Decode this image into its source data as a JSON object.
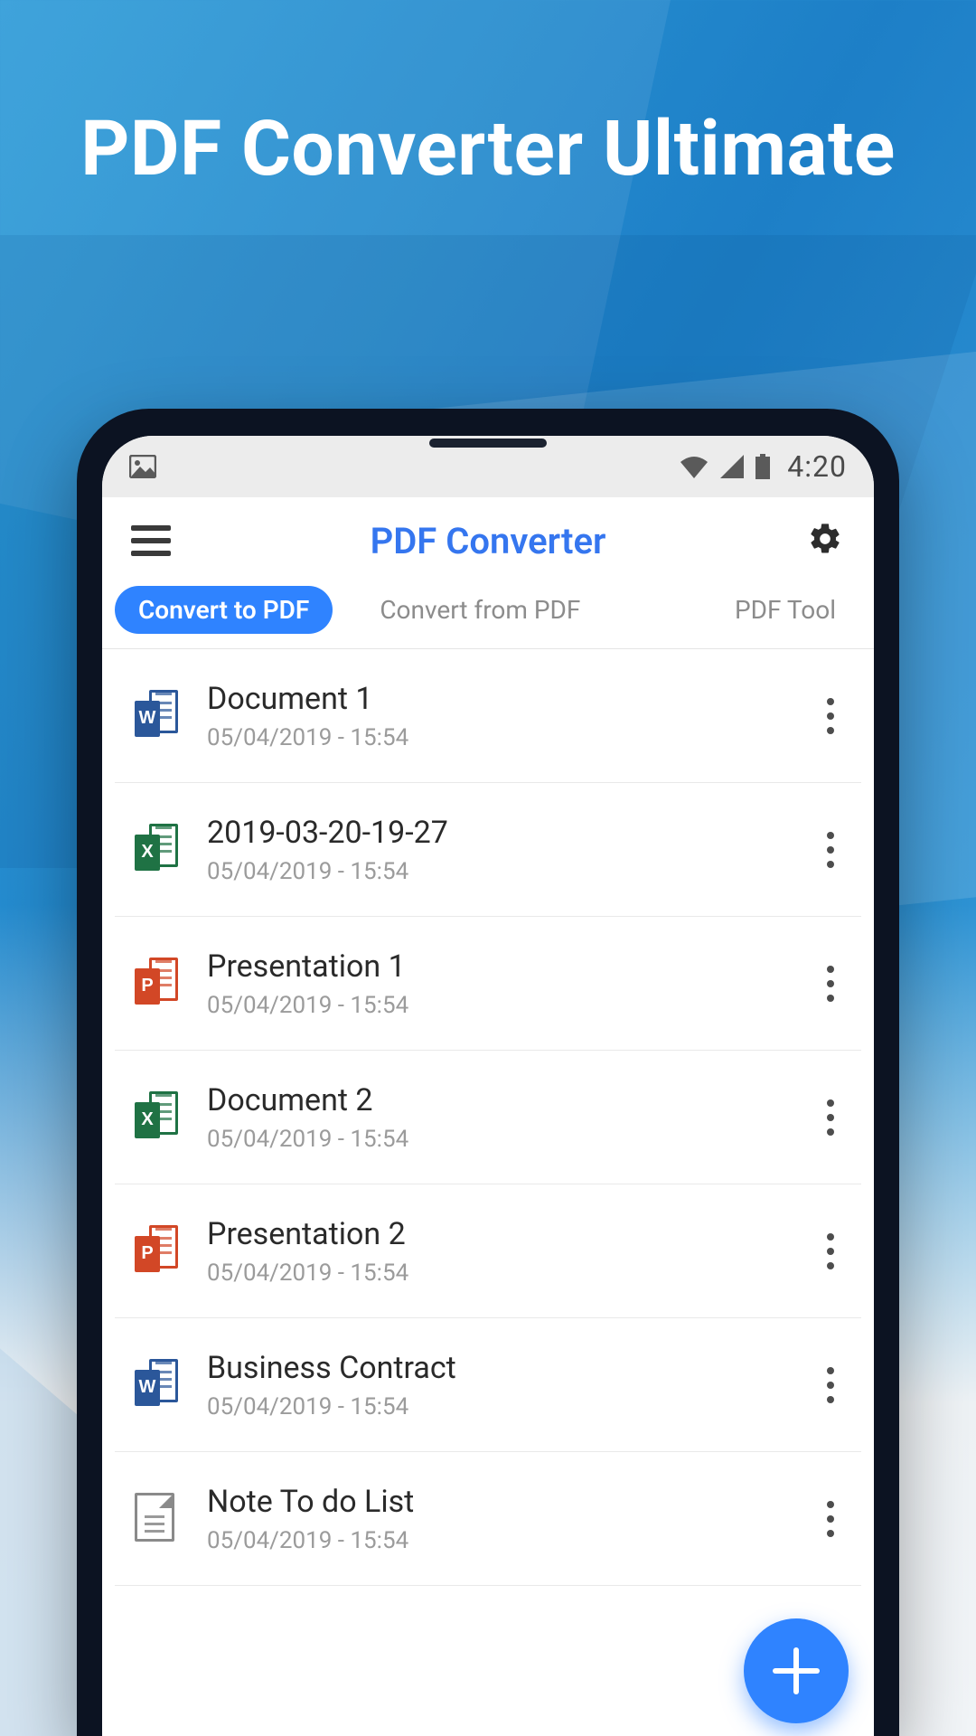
{
  "promo": {
    "title": "PDF Converter Ultimate"
  },
  "statusbar": {
    "time": "4:20"
  },
  "header": {
    "title": "PDF Converter"
  },
  "tabs": [
    {
      "label": "Convert to PDF",
      "active": true
    },
    {
      "label": "Convert from PDF",
      "active": false
    },
    {
      "label": "PDF Tool",
      "active": false
    }
  ],
  "files": [
    {
      "name": "Document 1",
      "date": "05/04/2019 - 15:54",
      "type": "word",
      "letter": "W"
    },
    {
      "name": "2019-03-20-19-27",
      "date": "05/04/2019 - 15:54",
      "type": "excel",
      "letter": "X"
    },
    {
      "name": "Presentation 1",
      "date": "05/04/2019 - 15:54",
      "type": "ppt",
      "letter": "P"
    },
    {
      "name": "Document 2",
      "date": "05/04/2019 - 15:54",
      "type": "excel",
      "letter": "X"
    },
    {
      "name": "Presentation 2",
      "date": "05/04/2019 - 15:54",
      "type": "ppt",
      "letter": "P"
    },
    {
      "name": "Business Contract",
      "date": "05/04/2019 - 15:54",
      "type": "word",
      "letter": "W"
    },
    {
      "name": "Note To do List",
      "date": "05/04/2019 - 15:54",
      "type": "txt",
      "letter": ""
    }
  ],
  "colors": {
    "accent": "#2f83ff",
    "titleBlue": "#3576ef"
  }
}
